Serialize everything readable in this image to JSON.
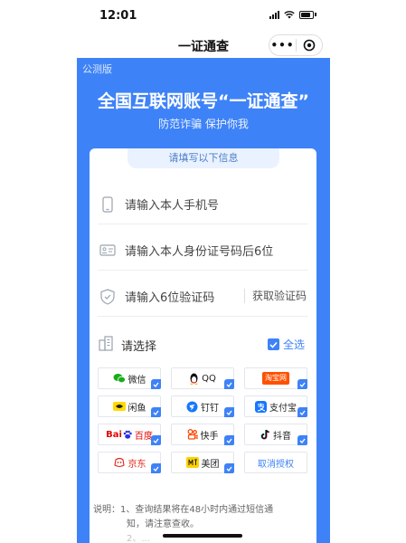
{
  "status_bar": {
    "time": "12:01"
  },
  "nav": {
    "title": "一证通查",
    "more_label": "•••"
  },
  "banner": {
    "edition": "公测版",
    "headline": "全国互联网账号“一证通查”",
    "slogan": "防范诈骗 保护你我"
  },
  "form": {
    "section_title": "请填写以下信息",
    "phone_placeholder": "请输入本人手机号",
    "id_placeholder": "请输入本人身份证号码后6位",
    "code_placeholder": "请输入6位验证码",
    "get_code_label": "获取验证码",
    "choose_label": "请选择",
    "select_all_label": "全选"
  },
  "apps": [
    {
      "label": "微信",
      "logo_text": "",
      "checked": true,
      "icon": "wechat-icon",
      "color": "#1aad19"
    },
    {
      "label": "QQ",
      "logo_text": "",
      "checked": true,
      "icon": "qq-penguin-icon",
      "color": "#111111"
    },
    {
      "label": "",
      "logo_text": "淘宝网",
      "checked": true,
      "icon": "taobao-icon",
      "color": "#ff5000"
    },
    {
      "label": "闲鱼",
      "logo_text": "",
      "checked": true,
      "icon": "xianyu-icon",
      "color": "#ffda00"
    },
    {
      "label": "钉钉",
      "logo_text": "",
      "checked": true,
      "icon": "dingtalk-icon",
      "color": "#1677ff"
    },
    {
      "label": "支付宝",
      "logo_text": "",
      "checked": true,
      "icon": "alipay-icon",
      "color": "#1677ff"
    },
    {
      "label": "百度",
      "logo_text": "Bai",
      "checked": true,
      "icon": "baidu-icon",
      "color": "#e10602"
    },
    {
      "label": "快手",
      "logo_text": "",
      "checked": true,
      "icon": "kuaishou-icon",
      "color": "#ff4906"
    },
    {
      "label": "抖音",
      "logo_text": "",
      "checked": true,
      "icon": "douyin-icon",
      "color": "#111111"
    },
    {
      "label": "京东",
      "logo_text": "",
      "checked": true,
      "icon": "jd-icon",
      "color": "#e1251b"
    },
    {
      "label": "美团",
      "logo_text": "",
      "checked": true,
      "icon": "meituan-icon",
      "color": "#ffd100"
    }
  ],
  "cancel_select_label": "取消授权",
  "note": {
    "line1": "说明：1、查询结果将在48小时内通过短信通",
    "line2": "知，请注意查收。",
    "line3": "2、..."
  },
  "colors": {
    "accent": "#3e82f7",
    "page_bg": "#ffffff"
  }
}
